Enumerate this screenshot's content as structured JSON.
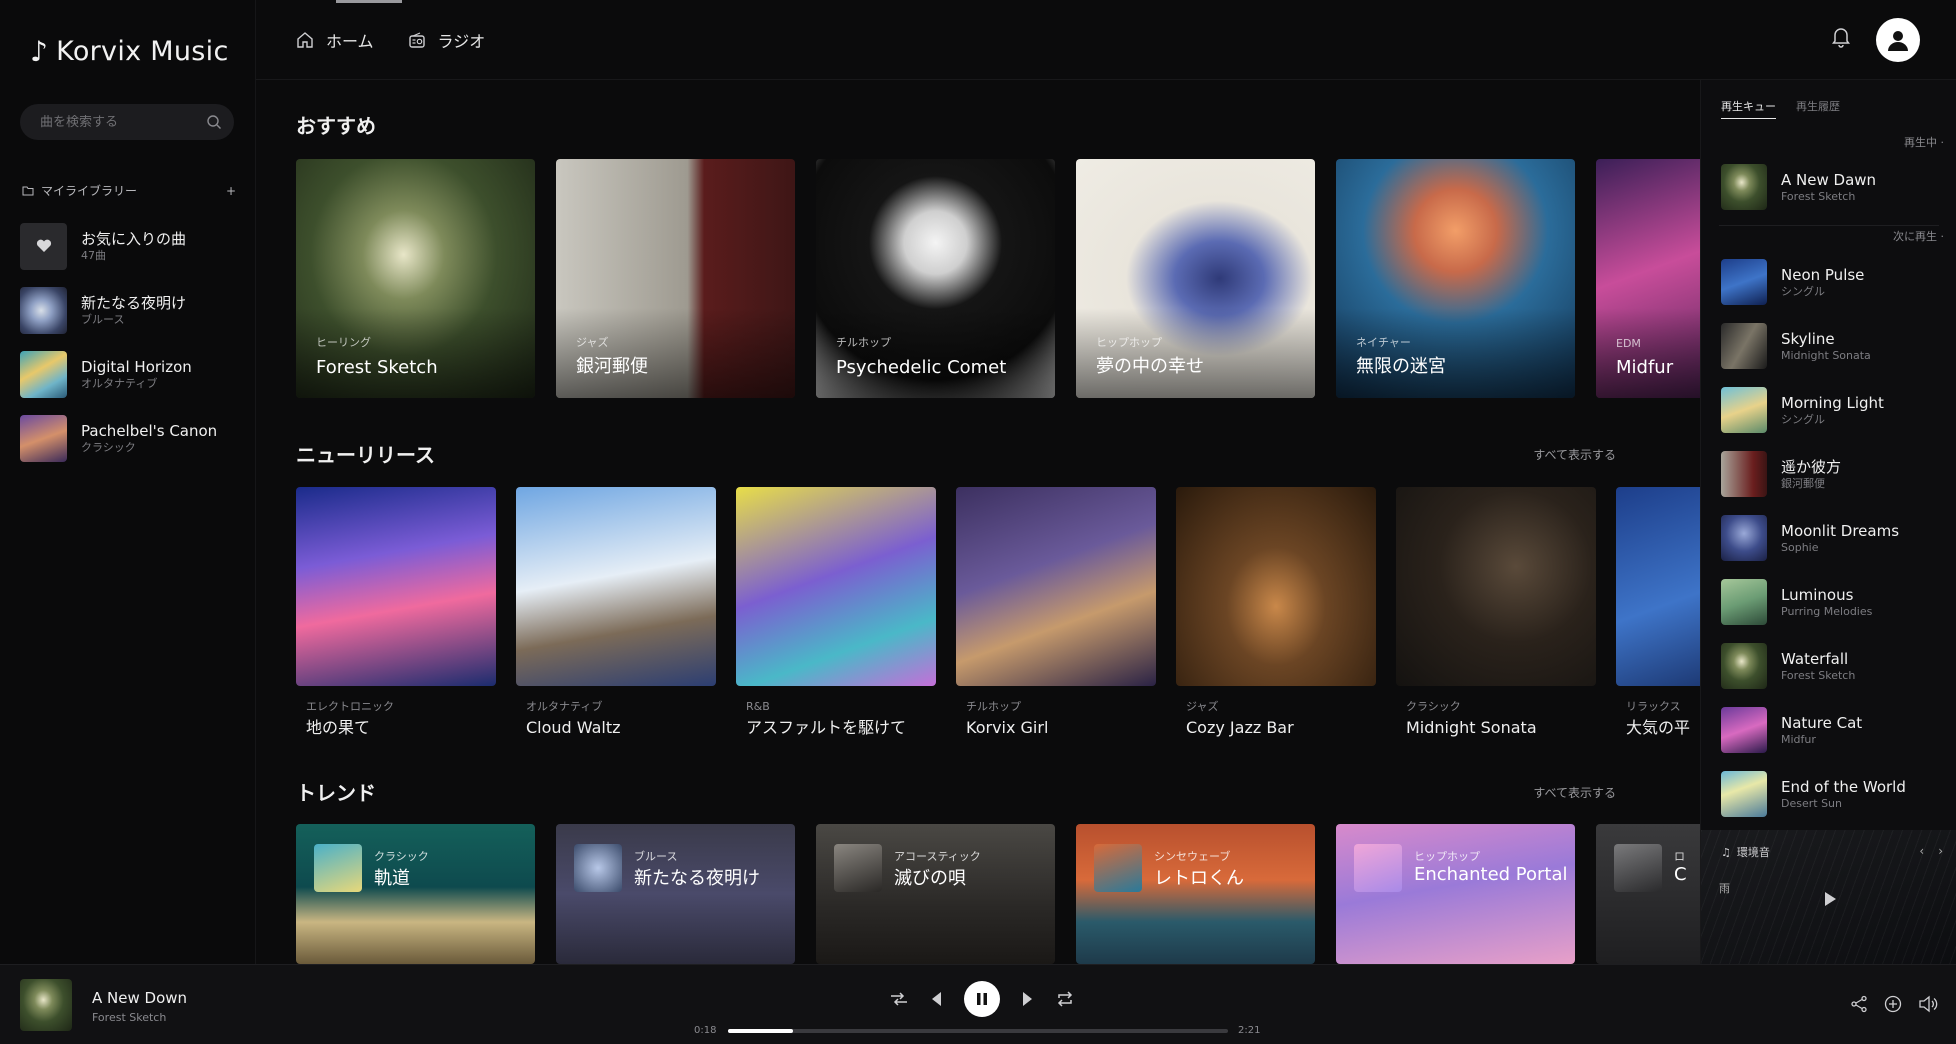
{
  "app": {
    "name": "Korvix Music"
  },
  "search": {
    "placeholder": "曲を検索する"
  },
  "library": {
    "heading": "マイライブラリー",
    "add_label": "+",
    "items": [
      {
        "title": "お気に入りの曲",
        "subtitle": "47曲"
      },
      {
        "title": "新たなる夜明け",
        "subtitle": "ブルース"
      },
      {
        "title": "Digital Horizon",
        "subtitle": "オルタナティブ"
      },
      {
        "title": "Pachelbel's Canon",
        "subtitle": "クラシック"
      }
    ]
  },
  "nav": {
    "home": "ホーム",
    "radio": "ラジオ"
  },
  "sections": {
    "recommended": {
      "title": "おすすめ",
      "cards": [
        {
          "genre": "ヒーリング",
          "name": "Forest Sketch"
        },
        {
          "genre": "ジャズ",
          "name": "銀河郵便"
        },
        {
          "genre": "チルホップ",
          "name": "Psychedelic Comet"
        },
        {
          "genre": "ヒップホップ",
          "name": "夢の中の幸せ"
        },
        {
          "genre": "ネイチャー",
          "name": "無限の迷宮"
        },
        {
          "genre": "EDM",
          "name": "Midfur"
        }
      ]
    },
    "new_releases": {
      "title": "ニューリリース",
      "see_all": "すべて表示する",
      "cards": [
        {
          "genre": "エレクトロニック",
          "name": "地の果て"
        },
        {
          "genre": "オルタナティブ",
          "name": "Cloud Waltz"
        },
        {
          "genre": "R&B",
          "name": "アスファルトを駆けて"
        },
        {
          "genre": "チルホップ",
          "name": "Korvix Girl"
        },
        {
          "genre": "ジャズ",
          "name": "Cozy Jazz Bar"
        },
        {
          "genre": "クラシック",
          "name": "Midnight Sonata"
        },
        {
          "genre": "リラックス",
          "name": "大気の平"
        }
      ]
    },
    "trending": {
      "title": "トレンド",
      "see_all": "すべて表示する",
      "cards": [
        {
          "genre": "クラシック",
          "name": "軌道"
        },
        {
          "genre": "ブルース",
          "name": "新たなる夜明け"
        },
        {
          "genre": "アコースティック",
          "name": "滅びの唄"
        },
        {
          "genre": "シンセウェーブ",
          "name": "レトロくん"
        },
        {
          "genre": "ヒップホップ",
          "name": "Enchanted Portal"
        },
        {
          "genre": "ロ",
          "name": "C"
        }
      ]
    }
  },
  "queue": {
    "tab_queue": "再生キュー",
    "tab_history": "再生履歴",
    "now_playing_label": "再生中",
    "next_label": "次に再生",
    "now_playing": {
      "title": "A New Dawn",
      "artist": "Forest Sketch"
    },
    "items": [
      {
        "title": "Neon Pulse",
        "artist": "シングル"
      },
      {
        "title": "Skyline",
        "artist": "Midnight Sonata"
      },
      {
        "title": "Morning Light",
        "artist": "シングル"
      },
      {
        "title": "遥か彼方",
        "artist": "銀河郵便"
      },
      {
        "title": "Moonlit Dreams",
        "artist": "Sophie"
      },
      {
        "title": "Luminous",
        "artist": "Purring Melodies"
      },
      {
        "title": "Waterfall",
        "artist": "Forest Sketch"
      },
      {
        "title": "Nature Cat",
        "artist": "Midfur"
      },
      {
        "title": "End of the World",
        "artist": "Desert Sun"
      }
    ],
    "ambient": {
      "label": "環境音",
      "side": "雨"
    }
  },
  "player": {
    "title": "A New Down",
    "artist": "Forest Sketch",
    "elapsed": "0:18",
    "duration": "2:21",
    "progress": 0.13
  },
  "colors": {
    "background": "#0b0b0c",
    "accent": "#ffffff",
    "muted": "#8a8a8f"
  }
}
